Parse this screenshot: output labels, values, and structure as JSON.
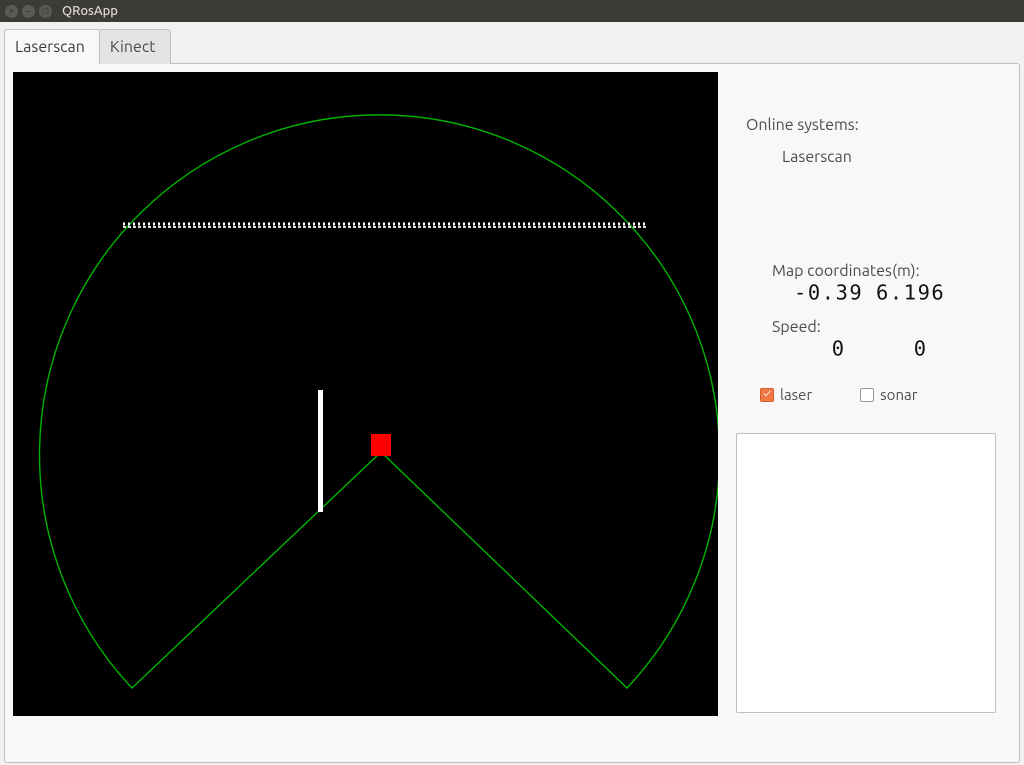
{
  "titlebar": {
    "app_title": "QRosApp"
  },
  "tabs": [
    {
      "label": "Laserscan",
      "active": true
    },
    {
      "label": "Kinect",
      "active": false
    }
  ],
  "side": {
    "online_systems_label": "Online systems:",
    "online_systems": [
      "Laserscan"
    ],
    "map_coord_label": "Map coordinates(m):",
    "map_coord_x": "-0.39",
    "map_coord_y": "6.196",
    "speed_label": "Speed:",
    "speed_x": "0",
    "speed_y": "0",
    "checks": {
      "laser_label": "laser",
      "laser_checked": true,
      "sonar_label": "sonar",
      "sonar_checked": false
    }
  },
  "laser": {
    "robot_color": "#ff0000",
    "arc_color": "#00aa00"
  }
}
